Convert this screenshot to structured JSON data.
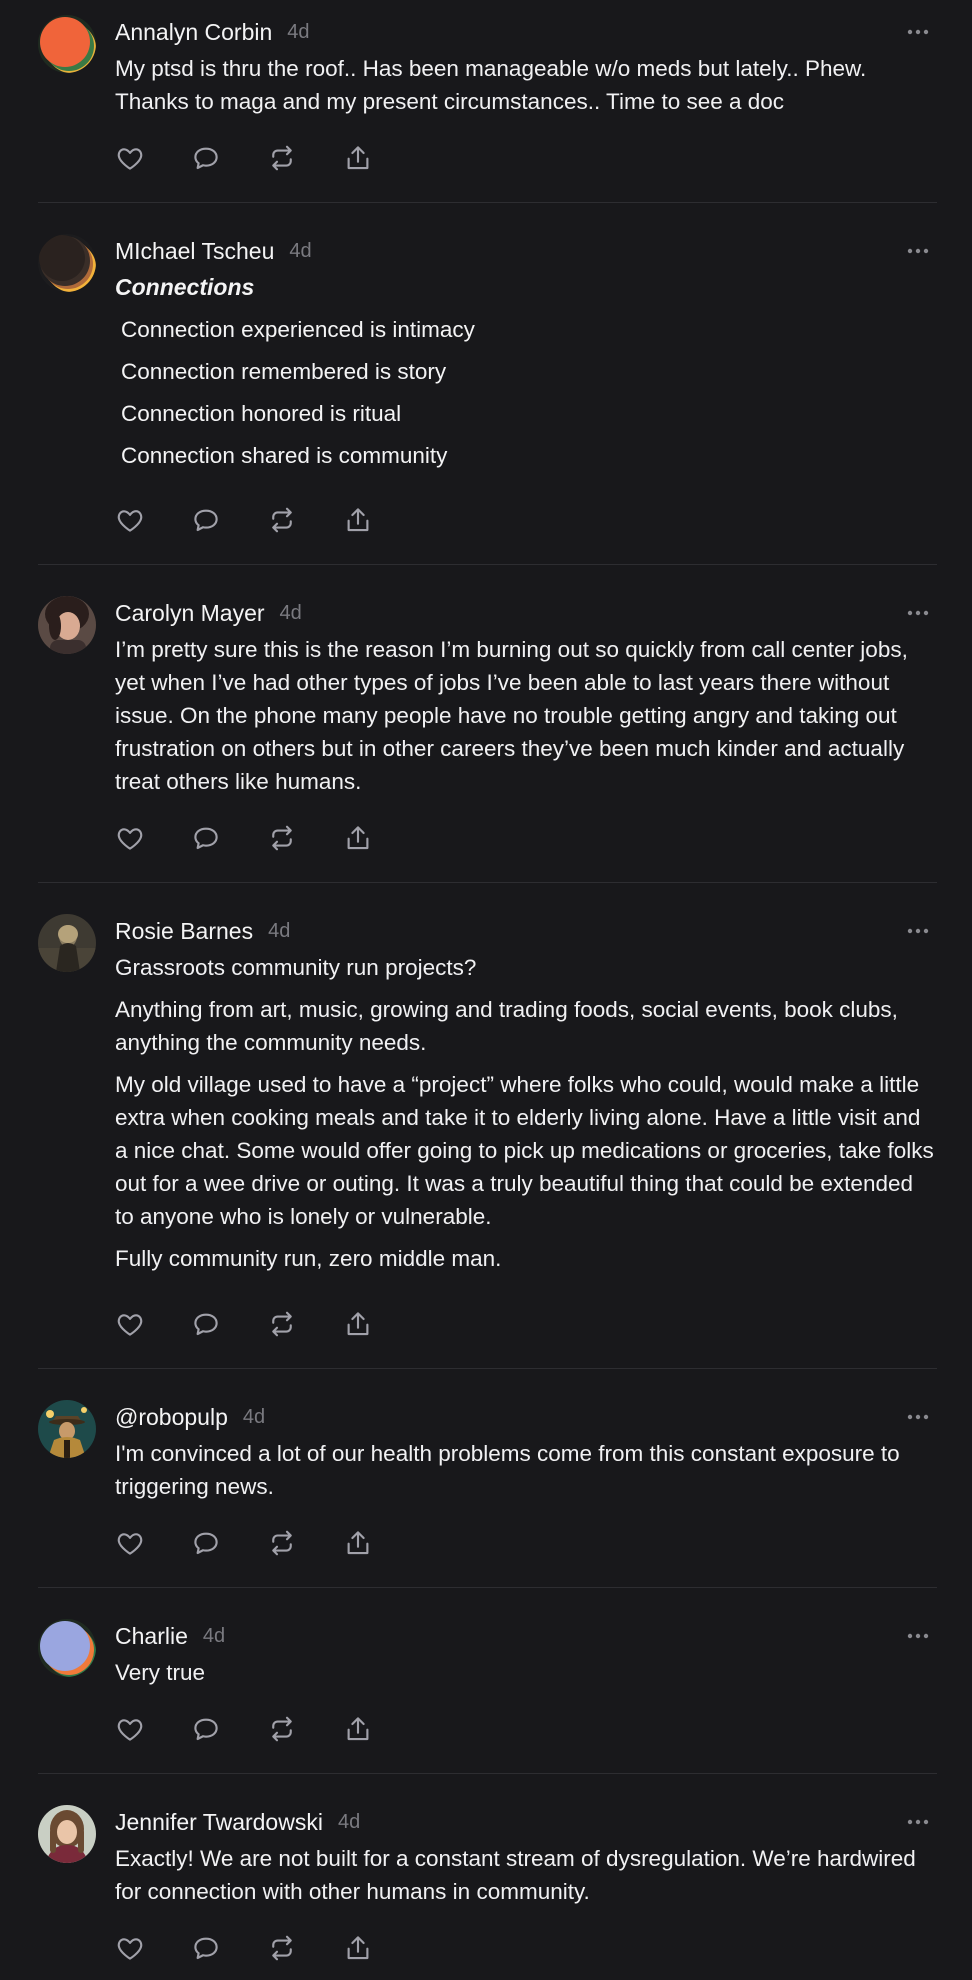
{
  "posts": [
    {
      "author": "Annalyn Corbin",
      "time": "4d",
      "paragraphs": [
        "My ptsd is thru the roof.. Has been manageable w/o meds but lately.. Phew. Thanks to maga and my present circumstances.. Time to see a doc"
      ]
    },
    {
      "author": "MIchael Tscheu",
      "time": "4d",
      "heading": "Connections",
      "lines": [
        "Connection experienced is intimacy",
        "Connection remembered is story",
        "Connection honored is ritual",
        "Connection shared is community"
      ]
    },
    {
      "author": "Carolyn Mayer",
      "time": "4d",
      "paragraphs": [
        "I’m pretty sure this is the reason I’m burning out so quickly from call center jobs, yet when I’ve had other types of jobs I’ve been able to last years there without issue. On the phone many people have no trouble getting angry and taking out frustration on others but in other careers they’ve been much kinder and actually treat others like humans."
      ]
    },
    {
      "author": "Rosie Barnes",
      "time": "4d",
      "paragraphs": [
        "Grassroots community run projects?",
        "Anything from art, music, growing and trading foods, social events, book clubs, anything the community needs.",
        "My old village used to have a “project” where folks who could, would make a little extra when cooking meals and take it to elderly living alone. Have a little visit and a nice chat. Some would offer going to pick up medications or groceries, take folks out for a wee drive or outing. It was a truly beautiful thing that could be extended to anyone who is lonely or vulnerable.",
        "Fully community run, zero middle man."
      ]
    },
    {
      "author": "@robopulp",
      "time": "4d",
      "paragraphs": [
        "I'm convinced a lot of our health problems come from this constant exposure to triggering news."
      ]
    },
    {
      "author": "Charlie",
      "time": "4d",
      "paragraphs": [
        "Very true"
      ]
    },
    {
      "author": "Jennifer Twardowski",
      "time": "4d",
      "paragraphs": [
        "Exactly! We are not built for a constant stream of dysregulation. We’re hardwired for connection with other humans in community."
      ]
    }
  ],
  "icons": {
    "like": "heart-icon",
    "reply": "comment-icon",
    "repost": "repost-icon",
    "share": "share-icon",
    "more": "more-icon"
  },
  "colors": {
    "background": "#18181b",
    "text": "#f4f4f5",
    "muted": "#7a7a80",
    "divider": "#2d2d31",
    "icon": "#a1a1aa"
  }
}
